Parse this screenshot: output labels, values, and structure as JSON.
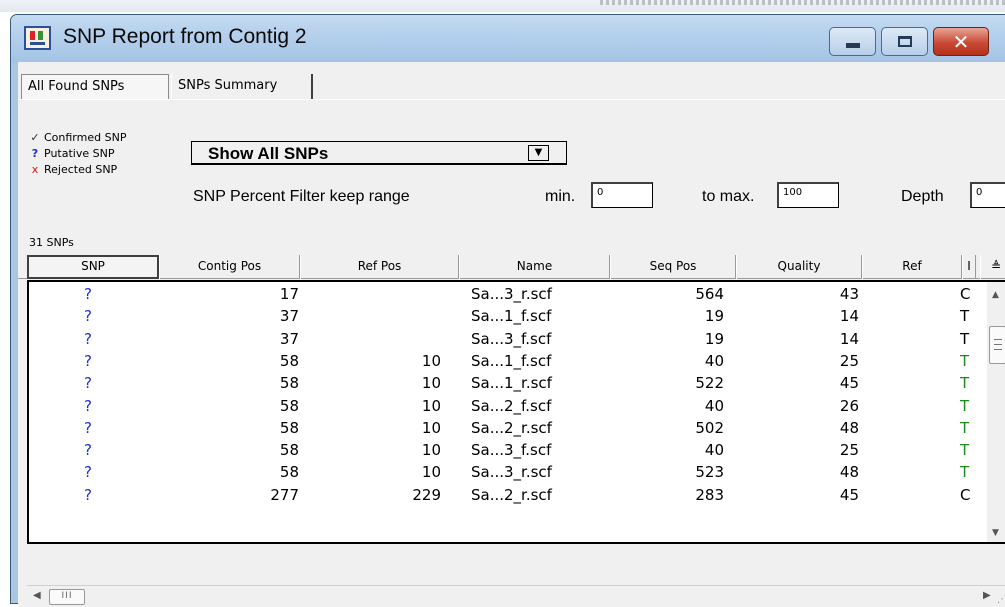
{
  "window": {
    "title": "SNP Report from Contig 2"
  },
  "tabs": [
    {
      "label": "All Found SNPs",
      "active": true
    },
    {
      "label": "SNPs Summary",
      "active": false
    }
  ],
  "legend": {
    "confirmed": {
      "symbol": "✓",
      "label": "Confirmed SNP"
    },
    "putative": {
      "symbol": "?",
      "label": "Putative SNP"
    },
    "rejected": {
      "symbol": "x",
      "label": "Rejected SNP"
    }
  },
  "filter": {
    "dropdown_value": "Show All SNPs",
    "percent_label": "SNP Percent Filter  keep range",
    "min_label": "min.",
    "min_value": "0",
    "max_label": "to max.",
    "max_value": "100",
    "depth_label": "Depth",
    "depth_value": "0"
  },
  "snp_count": "31 SNPs",
  "columns": [
    "SNP",
    "Contig Pos",
    "Ref Pos",
    "Name",
    "Seq Pos",
    "Quality",
    "Ref",
    "I"
  ],
  "rows": [
    {
      "snp": "?",
      "contig_pos": "17",
      "ref_pos": "",
      "name": "Sa...3_r.scf",
      "seq_pos": "564",
      "quality": "43",
      "ref": "C",
      "ref_color": "#000000"
    },
    {
      "snp": "?",
      "contig_pos": "37",
      "ref_pos": "",
      "name": "Sa...1_f.scf",
      "seq_pos": "19",
      "quality": "14",
      "ref": "T",
      "ref_color": "#000000"
    },
    {
      "snp": "?",
      "contig_pos": "37",
      "ref_pos": "",
      "name": "Sa...3_f.scf",
      "seq_pos": "19",
      "quality": "14",
      "ref": "T",
      "ref_color": "#000000"
    },
    {
      "snp": "?",
      "contig_pos": "58",
      "ref_pos": "10",
      "name": "Sa...1_f.scf",
      "seq_pos": "40",
      "quality": "25",
      "ref": "T",
      "ref_color": "#1d8a1d"
    },
    {
      "snp": "?",
      "contig_pos": "58",
      "ref_pos": "10",
      "name": "Sa...1_r.scf",
      "seq_pos": "522",
      "quality": "45",
      "ref": "T",
      "ref_color": "#1d8a1d"
    },
    {
      "snp": "?",
      "contig_pos": "58",
      "ref_pos": "10",
      "name": "Sa...2_f.scf",
      "seq_pos": "40",
      "quality": "26",
      "ref": "T",
      "ref_color": "#1d8a1d"
    },
    {
      "snp": "?",
      "contig_pos": "58",
      "ref_pos": "10",
      "name": "Sa...2_r.scf",
      "seq_pos": "502",
      "quality": "48",
      "ref": "T",
      "ref_color": "#1d8a1d"
    },
    {
      "snp": "?",
      "contig_pos": "58",
      "ref_pos": "10",
      "name": "Sa...3_f.scf",
      "seq_pos": "40",
      "quality": "25",
      "ref": "T",
      "ref_color": "#1d8a1d"
    },
    {
      "snp": "?",
      "contig_pos": "58",
      "ref_pos": "10",
      "name": "Sa...3_r.scf",
      "seq_pos": "523",
      "quality": "48",
      "ref": "T",
      "ref_color": "#1d8a1d"
    },
    {
      "snp": "?",
      "contig_pos": "277",
      "ref_pos": "229",
      "name": "Sa...2_r.scf",
      "seq_pos": "283",
      "quality": "45",
      "ref": "C",
      "ref_color": "#000000"
    }
  ],
  "colors": {
    "putative": "#1f2fd4",
    "rejected": "#d11414",
    "ref_match": "#1d8a1d",
    "titlebar": "#b3cfec",
    "close_button": "#c84a34"
  }
}
